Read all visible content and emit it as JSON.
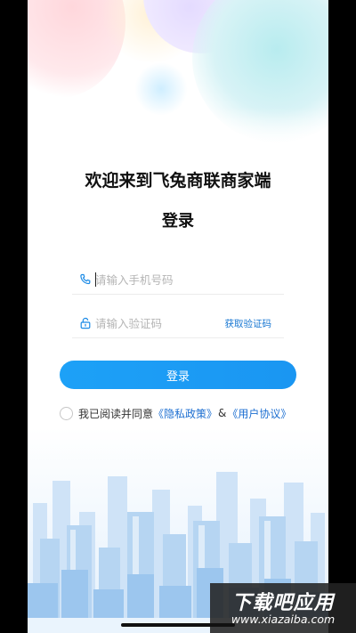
{
  "header": {
    "welcome": "欢迎来到飞兔商联商家端",
    "subtitle": "登录"
  },
  "form": {
    "phone_placeholder": "请输入手机号码",
    "code_placeholder": "请输入验证码",
    "get_code_label": "获取验证码",
    "login_label": "登录"
  },
  "agreement": {
    "prefix": "我已阅读并同意",
    "privacy_link": "《隐私政策》",
    "amp": "&",
    "user_link": "《用户协议》",
    "checked": false
  },
  "watermark": {
    "title": "下载吧应用",
    "url": "www.xiazaiba.com"
  },
  "colors": {
    "accent": "#1a9bf4",
    "link": "#1d6fd1"
  },
  "icons": {
    "phone": "phone-icon",
    "lock": "lock-icon",
    "radio": "radio-unchecked-icon"
  }
}
